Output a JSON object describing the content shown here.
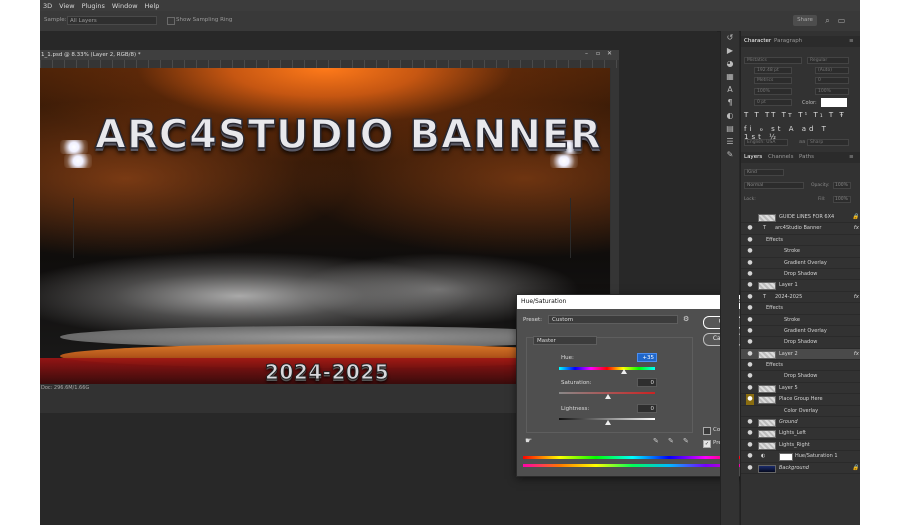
{
  "menu": [
    "3D",
    "View",
    "Plugins",
    "Window",
    "Help"
  ],
  "options": {
    "sample_label": "Sample:",
    "sample_value": "All Layers",
    "show_ring": "Show Sampling Ring",
    "share": "Share"
  },
  "document": {
    "tab_title": "1_1.psd @ 8.33% (Layer 2, RGB/8) *",
    "status": "Doc: 296.6M/1.66G"
  },
  "artwork": {
    "title": "ARC4STUDIO BANNER",
    "year": "2024-2025"
  },
  "panels": {
    "character_tabs": [
      "Character",
      "Paragraph"
    ],
    "character": {
      "color_label": "Color:",
      "language": "English: USA",
      "aa": "Sharp",
      "aa_label": "aa",
      "font": "Mistatics",
      "style": "Regular",
      "size": "192.48 pt",
      "leading": "(Auto)",
      "kerning": "Metrics",
      "tracking": "0",
      "vscale": "100%",
      "hscale": "100%",
      "baseline": "0 pt"
    },
    "layers_tabs": [
      "Layers",
      "Channels",
      "Paths"
    ],
    "layers_search": "Kind",
    "blend": "Normal",
    "opacity_label": "Opacity:",
    "opacity": "100%",
    "lock_label": "Lock:",
    "fill_label": "Fill:",
    "fill": "100%",
    "layers": [
      {
        "type": "layer",
        "name": "GUIDE LINES FOR 6X4",
        "eye": false,
        "lock": true
      },
      {
        "type": "text",
        "name": "arc4Studio Banner",
        "eye": true,
        "fx": true
      },
      {
        "type": "effect-head",
        "name": "Effects"
      },
      {
        "type": "effect",
        "name": "Stroke"
      },
      {
        "type": "effect",
        "name": "Gradient Overlay"
      },
      {
        "type": "effect",
        "name": "Drop Shadow"
      },
      {
        "type": "layer",
        "name": "Layer 1",
        "eye": true
      },
      {
        "type": "text",
        "name": "2024-2025",
        "eye": true,
        "fx": true
      },
      {
        "type": "effect-head",
        "name": "Effects"
      },
      {
        "type": "effect",
        "name": "Stroke"
      },
      {
        "type": "effect",
        "name": "Gradient Overlay"
      },
      {
        "type": "effect",
        "name": "Drop Shadow"
      },
      {
        "type": "layer",
        "name": "Layer 2",
        "eye": true,
        "fx": true,
        "selected": true
      },
      {
        "type": "effect-head",
        "name": "Effects"
      },
      {
        "type": "effect",
        "name": "Drop Shadow"
      },
      {
        "type": "layer",
        "name": "Layer 5",
        "eye": true
      },
      {
        "type": "layer",
        "name": "Place Group Here",
        "eye": true,
        "gold": true
      },
      {
        "type": "effect",
        "name": "Color Overlay"
      },
      {
        "type": "layer",
        "name": "Ground",
        "eye": true,
        "italic": true
      },
      {
        "type": "layer",
        "name": "Lights_Left",
        "eye": true
      },
      {
        "type": "layer",
        "name": "Lights_Right",
        "eye": true
      },
      {
        "type": "adjust",
        "name": "Hue/Saturation 1",
        "eye": true
      },
      {
        "type": "layer",
        "name": "Background",
        "eye": true,
        "italic": true,
        "lock": true
      }
    ]
  },
  "dialog": {
    "title": "Hue/Saturation",
    "preset_label": "Preset:",
    "preset_value": "Custom",
    "channel": "Master",
    "hue_label": "Hue:",
    "hue_value": "+35",
    "sat_label": "Saturation:",
    "sat_value": "0",
    "light_label": "Lightness:",
    "light_value": "0",
    "colorize": "Colorize",
    "preview": "Preview",
    "ok": "OK",
    "cancel": "Cancel"
  },
  "colors": {
    "accent": "#1f66c9",
    "bg": "#282828",
    "panel": "#323232",
    "dialog": "#4f4f4f"
  }
}
